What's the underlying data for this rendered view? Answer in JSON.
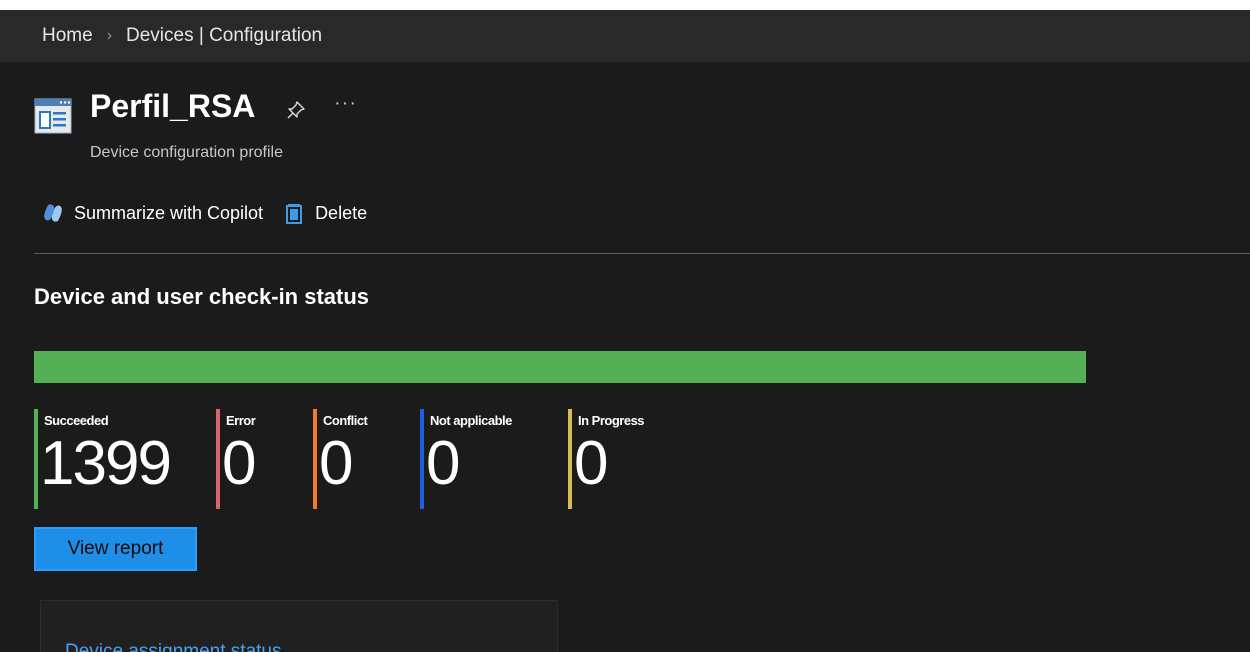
{
  "breadcrumb": {
    "home": "Home",
    "separator": "›",
    "current": "Devices | Configuration"
  },
  "header": {
    "title": "Perfil_RSA",
    "subtitle": "Device configuration profile",
    "more": "···"
  },
  "toolbar": {
    "copilot_label": "Summarize with Copilot",
    "delete_label": "Delete"
  },
  "checkin": {
    "title": "Device and user check-in status",
    "progress_fraction": 1.0,
    "stats": [
      {
        "label": "Succeeded",
        "value": "1399",
        "color": "#55b055"
      },
      {
        "label": "Error",
        "value": "0",
        "color": "#d9646b"
      },
      {
        "label": "Conflict",
        "value": "0",
        "color": "#f07a2e"
      },
      {
        "label": "Not applicable",
        "value": "0",
        "color": "#1f5fe0"
      },
      {
        "label": "In Progress",
        "value": "0",
        "color": "#d8bd55"
      }
    ],
    "view_report_label": "View report"
  },
  "card": {
    "title": "Device assignment status"
  },
  "colors": {
    "background": "#1b1b1b",
    "breadcrumb_bg": "#292929",
    "accent": "#1e8fe8",
    "link": "#4aa3f0"
  }
}
